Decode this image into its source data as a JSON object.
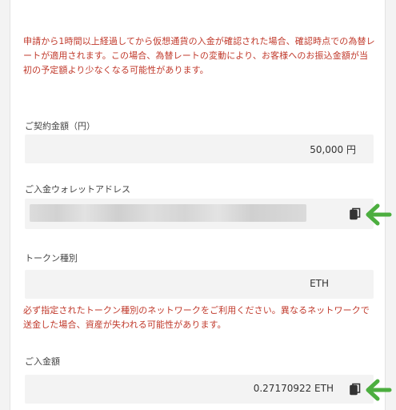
{
  "notices": {
    "rate_notice": "申請から1時間以上経過してから仮想通貨の入金が確認された場合、確認時点での為替レートが適用されます。この場合、為替レートの変動により、お客様へのお振込金額が当初の予定額より少なくなる可能性があります。",
    "network_notice": "必ず指定されたトークン種別のネットワークをご利用ください。異なるネットワークで送金した場合、資産が失われる可能性があります。"
  },
  "contract_amount": {
    "label": "ご契約金額（円）",
    "value": "50,000 円"
  },
  "wallet_address": {
    "label": "ご入金ウォレットアドレス",
    "value_state": "blurred",
    "copy_icon": "copy-icon"
  },
  "token_type": {
    "label": "トークン種別",
    "value": "ETH"
  },
  "deposit_amount": {
    "label": "ご入金額",
    "value": "0.27170922 ETH",
    "copy_icon": "copy-icon"
  },
  "annotation": {
    "arrow_color": "#4cae3f"
  },
  "colors": {
    "notice_text": "#c0392b",
    "field_bg": "#f3f3f3",
    "label_text": "#444444"
  }
}
